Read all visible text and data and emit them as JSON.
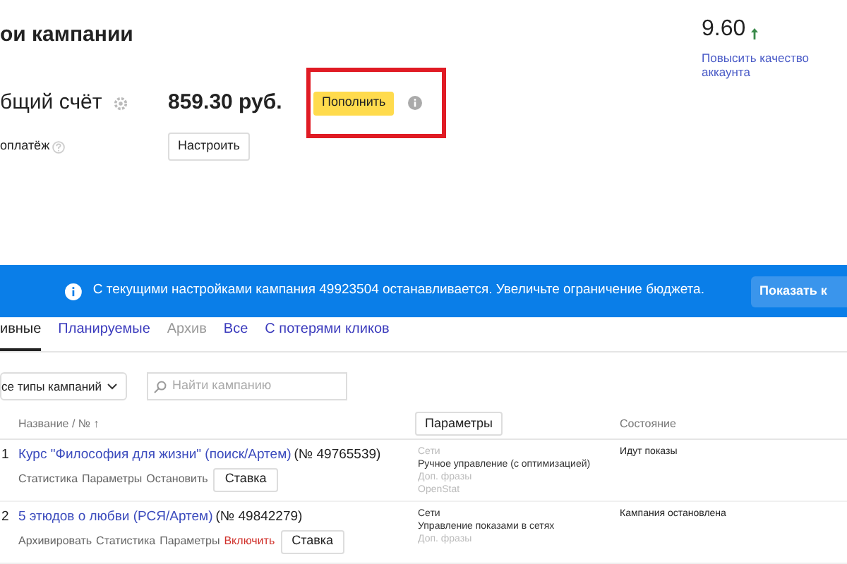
{
  "page_title": "ои кампании",
  "account": {
    "label": "бщий счёт",
    "amount": "859.30 руб.",
    "topup_button": "Пополнить",
    "highlighted": true,
    "autopay_label": "оплатёж",
    "setup_button": "Настроить"
  },
  "quality": {
    "score": "9.60",
    "link": "Повысить качество аккаунта"
  },
  "banner": {
    "text": "С текущими настройками кампания 49923504 останавливается. Увеличьте ограничение бюджета.",
    "button": "Показать к"
  },
  "tabs": [
    {
      "label": "ивные",
      "selected": true,
      "muted": false
    },
    {
      "label": "Планируемые",
      "selected": false,
      "muted": false
    },
    {
      "label": "Архив",
      "selected": false,
      "muted": true
    },
    {
      "label": "Все",
      "selected": false,
      "muted": false
    },
    {
      "label": "С потерями кликов",
      "selected": false,
      "muted": false
    }
  ],
  "filters": {
    "type_dropdown": "се типы кампаний",
    "search_placeholder": "Найти кампанию"
  },
  "table": {
    "columns": [
      "Название / № ↑",
      "Параметры",
      "Состояние"
    ],
    "rows": [
      {
        "index": "1",
        "name": "Курс \"Философия для жизни\" (поиск/Артем)",
        "number": "(№ 49765539)",
        "actions": [
          {
            "label": "Статистика",
            "kind": "link"
          },
          {
            "label": "Параметры",
            "kind": "link"
          },
          {
            "label": "Остановить",
            "kind": "link"
          },
          {
            "label": "Ставка",
            "kind": "button"
          }
        ],
        "params": [
          {
            "text": "Сети",
            "active": false
          },
          {
            "text": "Ручное управление (с оптимизацией)",
            "active": true
          },
          {
            "text": "Доп. фразы",
            "active": false
          },
          {
            "text": "OpenStat",
            "active": false
          }
        ],
        "status": "Идут показы"
      },
      {
        "index": "2",
        "name": "5 этюдов о любви (РСЯ/Артем)",
        "number": "(№ 49842279)",
        "actions": [
          {
            "label": "Архивировать",
            "kind": "link"
          },
          {
            "label": "Статистика",
            "kind": "link"
          },
          {
            "label": "Параметры",
            "kind": "link"
          },
          {
            "label": "Включить",
            "kind": "danger"
          },
          {
            "label": "Ставка",
            "kind": "button"
          }
        ],
        "params": [
          {
            "text": "Сети",
            "active": true
          },
          {
            "text": "Управление показами в сетях",
            "active": true
          },
          {
            "text": "Доп. фразы",
            "active": false
          }
        ],
        "status": "Кампания остановлена"
      }
    ]
  }
}
